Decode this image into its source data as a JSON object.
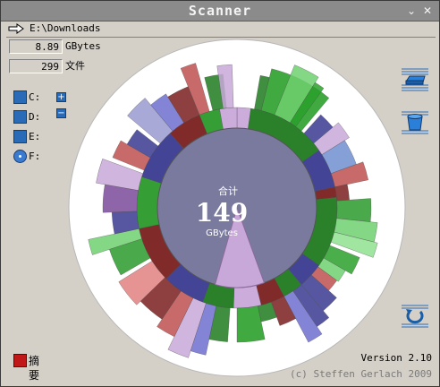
{
  "window": {
    "title": "Scanner",
    "minimize_icon": "minimize-icon",
    "close_icon": "close-icon"
  },
  "path": {
    "text": "E:\\Downloads",
    "icon": "arrow-right-icon"
  },
  "stats": {
    "size_value": "8.89",
    "size_unit": "GBytes",
    "count_value": "299",
    "count_unit": "文件"
  },
  "drives": [
    {
      "label": "C:",
      "icon": "hard-drive-icon"
    },
    {
      "label": "D:",
      "icon": "hard-drive-icon"
    },
    {
      "label": "E:",
      "icon": "hard-drive-icon"
    },
    {
      "label": "F:",
      "icon": "cd-drive-icon"
    }
  ],
  "zoom": {
    "plus_icon": "plus-icon",
    "minus_icon": "minus-icon"
  },
  "toolbar": {
    "drive_button_icon": "drive-icon",
    "recycle_button_icon": "recycle-bin-icon",
    "refresh_button_icon": "refresh-icon"
  },
  "center": {
    "title": "合计",
    "value": "149",
    "unit": "GBytes"
  },
  "summary": {
    "label": "摘要",
    "icon": "summary-icon"
  },
  "footer": {
    "version": "Version 2.10",
    "copyright": "(c) Steffen Gerlach 2009"
  },
  "colors": {
    "window_bg": "#d4d0c8",
    "titlebar": "#8b8b8b",
    "chart_bg": "#ffffff",
    "center_disk": "#7a7a9e",
    "highlight_slice": "#c8a8d8",
    "accent_blue": "#2a6bb8",
    "summary_red": "#c01818"
  }
}
